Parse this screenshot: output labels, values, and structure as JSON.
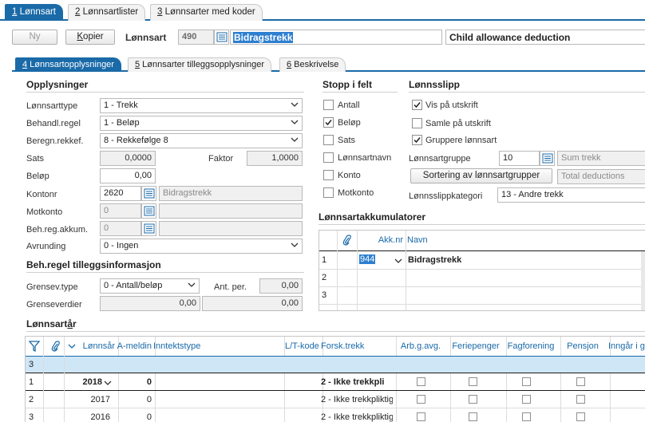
{
  "top_tabs": [
    {
      "key": "1",
      "label": " Lønnsart",
      "active": true
    },
    {
      "key": "2",
      "label": " Lønnsartlister",
      "active": false
    },
    {
      "key": "3",
      "label": " Lønnsarter med koder",
      "active": false
    }
  ],
  "toolbar": {
    "new_label": "Ny",
    "copy_label_pre": "K",
    "copy_label_post": "opier",
    "lonnsart_label": "Lønnsart",
    "number": "490",
    "name": "Bidragstrekk",
    "english_name": "Child allowance deduction"
  },
  "sub_tabs": [
    {
      "key": "4",
      "label": " Lønnsartopplysninger",
      "active": true
    },
    {
      "key": "5",
      "label": " Lønnsarter tilleggsopplysninger",
      "active": false
    },
    {
      "key": "6",
      "label": " Beskrivelse",
      "active": false
    }
  ],
  "opplysninger": {
    "title": "Opplysninger",
    "lonnsarttype_label": "Lønnsarttype",
    "lonnsarttype_value": "1 - Trekk",
    "behandl_label": "Behandl.regel",
    "behandl_value": "1 - Beløp",
    "beregn_label": "Beregn.rekkef.",
    "beregn_value": "8 - Rekkefølge 8",
    "sats_label": "Sats",
    "sats_value": "0,0000",
    "faktor_label": "Faktor",
    "faktor_value": "1,0000",
    "belop_label": "Beløp",
    "belop_value": "0,00",
    "kontonr_label": "Kontonr",
    "kontonr_value": "2620",
    "kontonr_name": "Bidragstrekk",
    "motkonto_label": "Motkonto",
    "motkonto_value": "0",
    "behreg_label": "Beh.reg.akkum.",
    "behreg_value": "0",
    "avrunding_label": "Avrunding",
    "avrunding_value": "0 - Ingen"
  },
  "behregel": {
    "title": "Beh.regel tilleggsinformasjon",
    "grensev_label": "Grensev.type",
    "grensev_value": "0 - Antall/beløp",
    "antper_label": "Ant. per.",
    "antper_value": "0,00",
    "grenseverdier_label": "Grenseverdier",
    "grenseverdi1": "0,00",
    "grenseverdi2": "0,00"
  },
  "stopp": {
    "title": "Stopp i felt",
    "items": [
      {
        "label": "Antall",
        "checked": false
      },
      {
        "label": "Beløp",
        "checked": true
      },
      {
        "label": "Sats",
        "checked": false
      },
      {
        "label": "Lønnsartnavn",
        "checked": false
      },
      {
        "label": "Konto",
        "checked": false
      },
      {
        "label": "Motkonto",
        "checked": false
      }
    ]
  },
  "lonnsslipp": {
    "title": "Lønnsslipp",
    "vis_label": "Vis på utskrift",
    "vis_checked": true,
    "samle_label": "Samle på utskrift",
    "samle_checked": false,
    "gruppere_label": "Gruppere lønnsart",
    "gruppere_checked": true,
    "gruppe_label": "Lønnsartgruppe",
    "gruppe_value": "10",
    "gruppe_name": "Sum trekk",
    "sortering_label": "Sortering av lønnsartgrupper",
    "total_label": "Total deductions",
    "kategori_label": "Lønnsslippkategori",
    "kategori_value": "13 - Andre trekk"
  },
  "akkumulatorer": {
    "title": "Lønnsartakkumulatorer",
    "col_akknr": "Akk.nr",
    "col_navn": "Navn",
    "rows": [
      {
        "n": "1",
        "akknr": "944",
        "navn": "Bidragstrekk"
      },
      {
        "n": "2",
        "akknr": "",
        "navn": ""
      },
      {
        "n": "3",
        "akknr": "",
        "navn": ""
      }
    ]
  },
  "lonnsartar": {
    "title_pre": "Lønnsart",
    "title_u": "å",
    "title_post": "r",
    "columns": [
      "Lønnsår",
      "A-meldin",
      "Inntektstype",
      "L/T-kode",
      "Forsk.trekk",
      "Arb.g.avg.",
      "Feriepenger",
      "Fagforening",
      "Pensjon",
      "Inngår i gr"
    ],
    "new_row_n": "3",
    "rows": [
      {
        "n": "1",
        "year": "2018",
        "amelding": "0",
        "forsk": "2 - Ikke trekkpli",
        "bold": true
      },
      {
        "n": "2",
        "year": "2017",
        "amelding": "0",
        "forsk": "2 - Ikke trekkpliktig",
        "bold": false
      },
      {
        "n": "3",
        "year": "2016",
        "amelding": "0",
        "forsk": "2 - Ikke trekkpliktig",
        "bold": false
      }
    ]
  },
  "colors": {
    "accent": "#1a6aa8",
    "selected_row": "#cfe6f7",
    "highlight": "#2e7fd0"
  }
}
